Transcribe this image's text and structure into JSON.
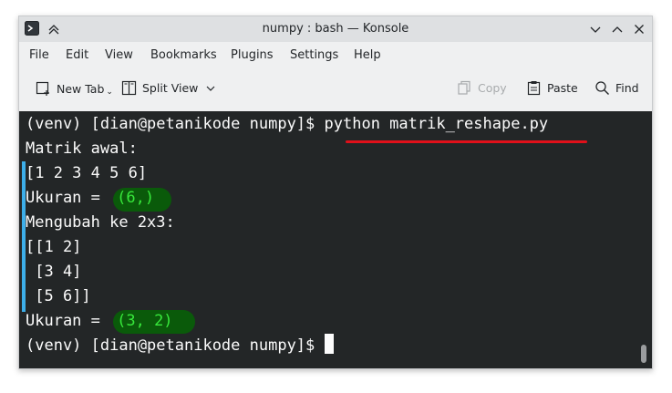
{
  "window": {
    "title": "numpy : bash — Konsole"
  },
  "menu": {
    "items": [
      "File",
      "Edit",
      "View",
      "Bookmarks",
      "Plugins",
      "Settings",
      "Help"
    ]
  },
  "toolbar": {
    "new_tab": "New Tab",
    "split_view": "Split View",
    "copy": "Copy",
    "paste": "Paste",
    "find": "Find"
  },
  "terminal": {
    "lines": [
      "(venv) [dian@petanikode numpy]$ python matrik_reshape.py",
      "Matrik awal:",
      "[1 2 3 4 5 6]",
      "Ukuran = ",
      "Mengubah ke 2x3:",
      "[[1 2]",
      " [3 4]",
      " [5 6]]",
      "Ukuran = ",
      "(venv) [dian@petanikode numpy]$ "
    ],
    "shape1": "(6,)",
    "shape2": "(3, 2)"
  },
  "colors": {
    "accent": "#3daee9",
    "terminal_bg": "#232627",
    "highlight_text": "#37e83b",
    "underline": "#e0101a"
  }
}
